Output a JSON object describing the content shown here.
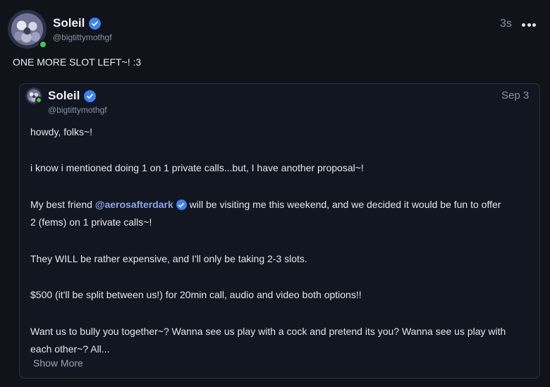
{
  "post": {
    "author": {
      "display_name": "Soleil",
      "handle": "@bigtittymothgf"
    },
    "timestamp": "3s",
    "text": "ONE MORE SLOT LEFT~! :3",
    "icons": {
      "verified": "verified-badge-icon",
      "more": "more-options-icon"
    }
  },
  "quoted_post": {
    "author": {
      "display_name": "Soleil",
      "handle": "@bigtittymothgf"
    },
    "timestamp": "Sep 3",
    "lines": {
      "l1": "howdy, folks~!",
      "l2": "i know i mentioned doing 1 on 1 private calls...but, I have another proposal~!",
      "l3_pre": "My best friend ",
      "l3_mention": "@aerosafterdark",
      "l3_post": " will be visiting me this weekend, and we decided it would be fun to offer",
      "l4": "2 (fems) on 1 private calls~!",
      "l5": "They WILL be rather expensive, and I'll only be taking 2-3 slots.",
      "l6": "$500 (it'll be split between us!) for 20min call, audio and video both options!!",
      "l7": "Want us to bully you together~? Wanna see us play with a cock and pretend its you? Wanna see us play with",
      "l8": "each other~? All..."
    },
    "show_more_label": "Show More"
  },
  "colors": {
    "background": "#10131a",
    "accent": "#3b82f6",
    "online": "#3ecb4f",
    "mention": "#8ba6e8"
  }
}
